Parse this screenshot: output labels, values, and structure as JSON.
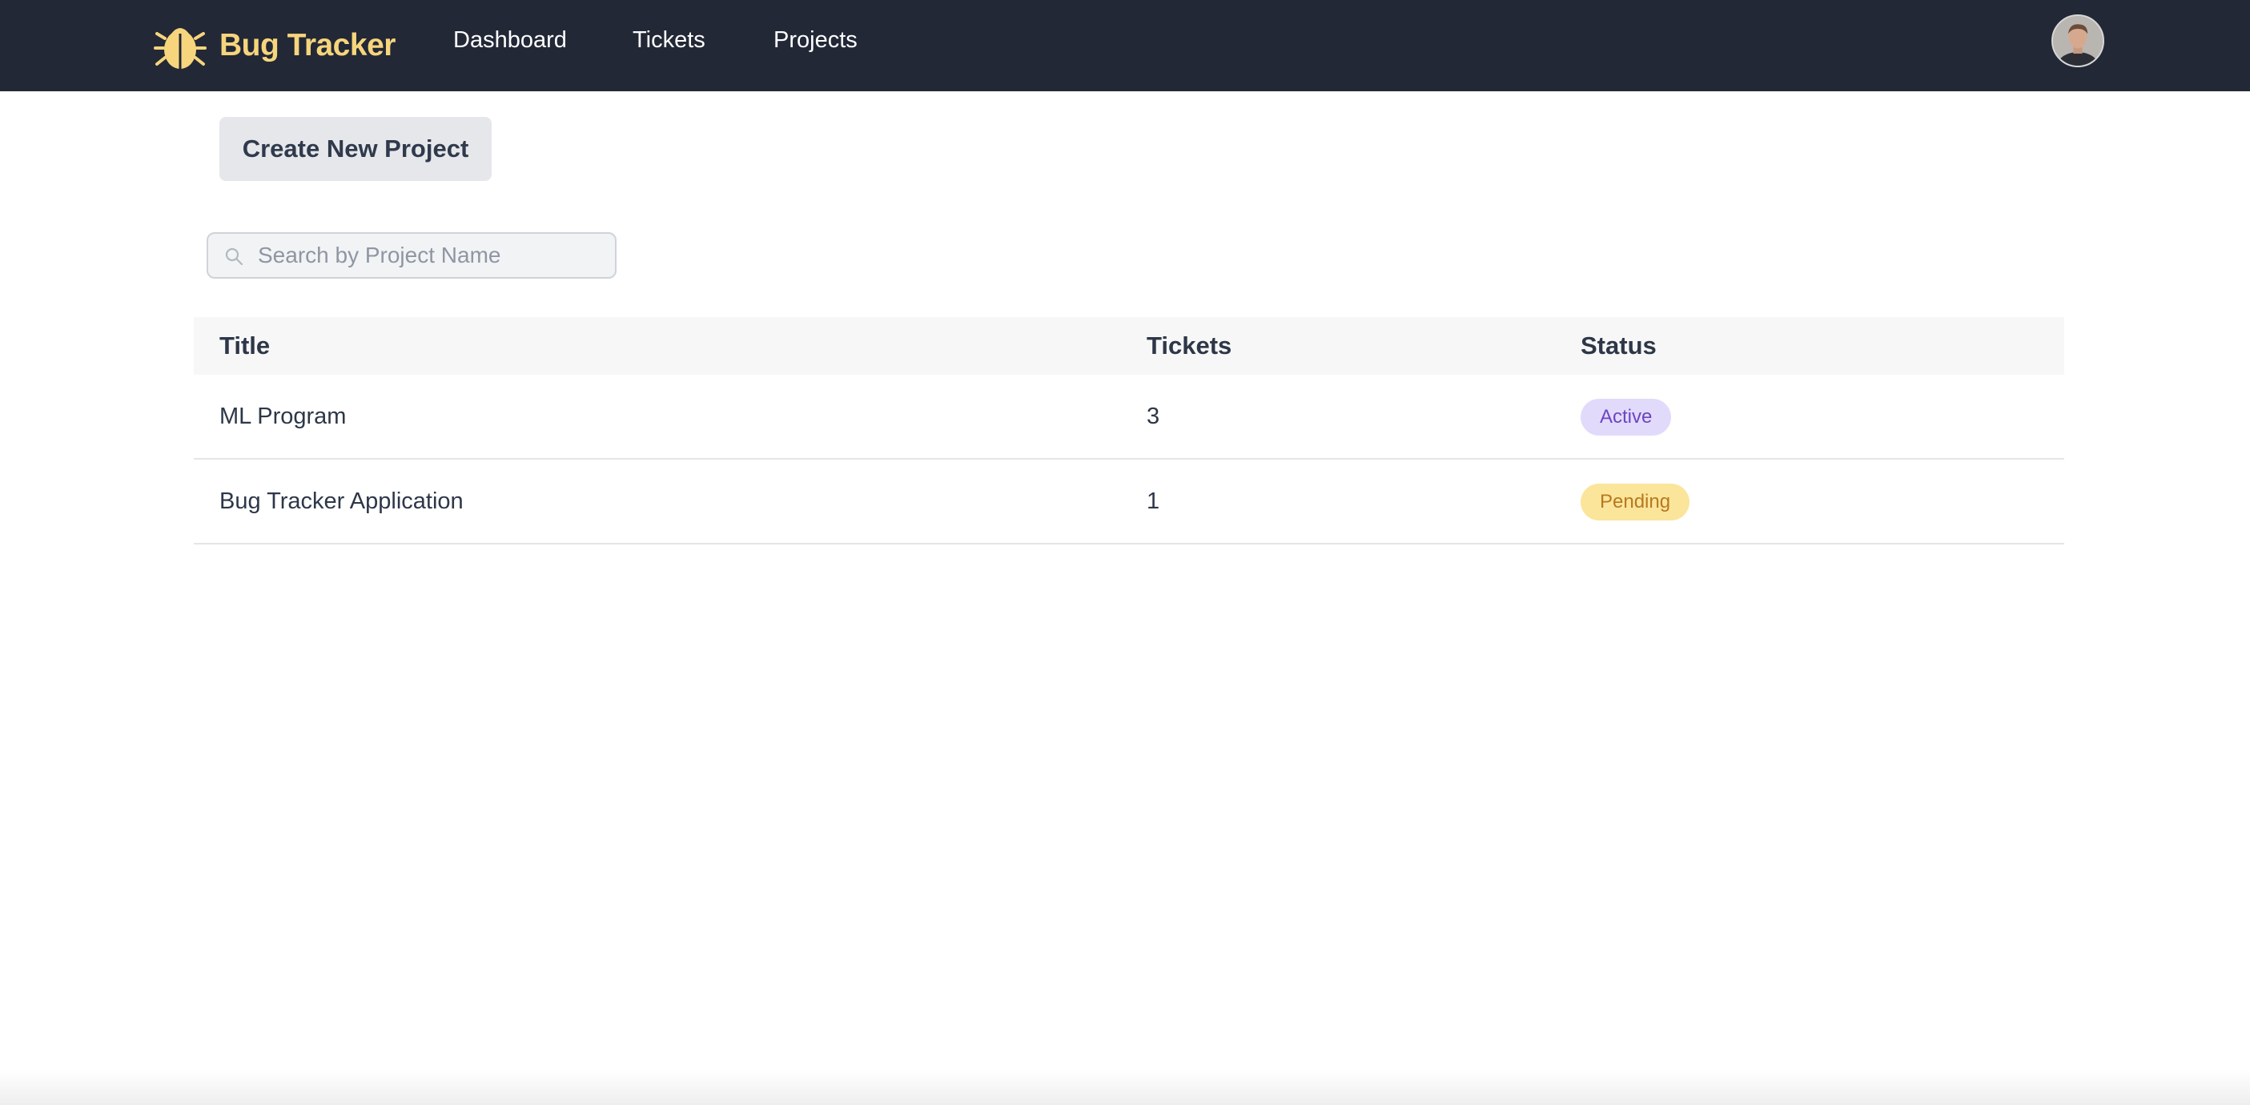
{
  "navbar": {
    "brand": "Bug Tracker",
    "brand_icon": "bug-icon",
    "links": [
      "Dashboard",
      "Tickets",
      "Projects"
    ],
    "avatar_icon": "user-avatar",
    "bg_color": "#222836",
    "brand_color": "#f6d57c"
  },
  "actions": {
    "create_label": "Create New Project"
  },
  "search": {
    "placeholder": "Search by Project Name",
    "value": "",
    "icon": "search-icon"
  },
  "table": {
    "columns": [
      "Title",
      "Tickets",
      "Status"
    ],
    "rows": [
      {
        "title": "ML Program",
        "tickets": "3",
        "status": "Active",
        "status_color": "#6b46c1"
      },
      {
        "title": "Bug Tracker Application",
        "tickets": "1",
        "status": "Pending",
        "status_color": "#b7791f"
      }
    ]
  }
}
